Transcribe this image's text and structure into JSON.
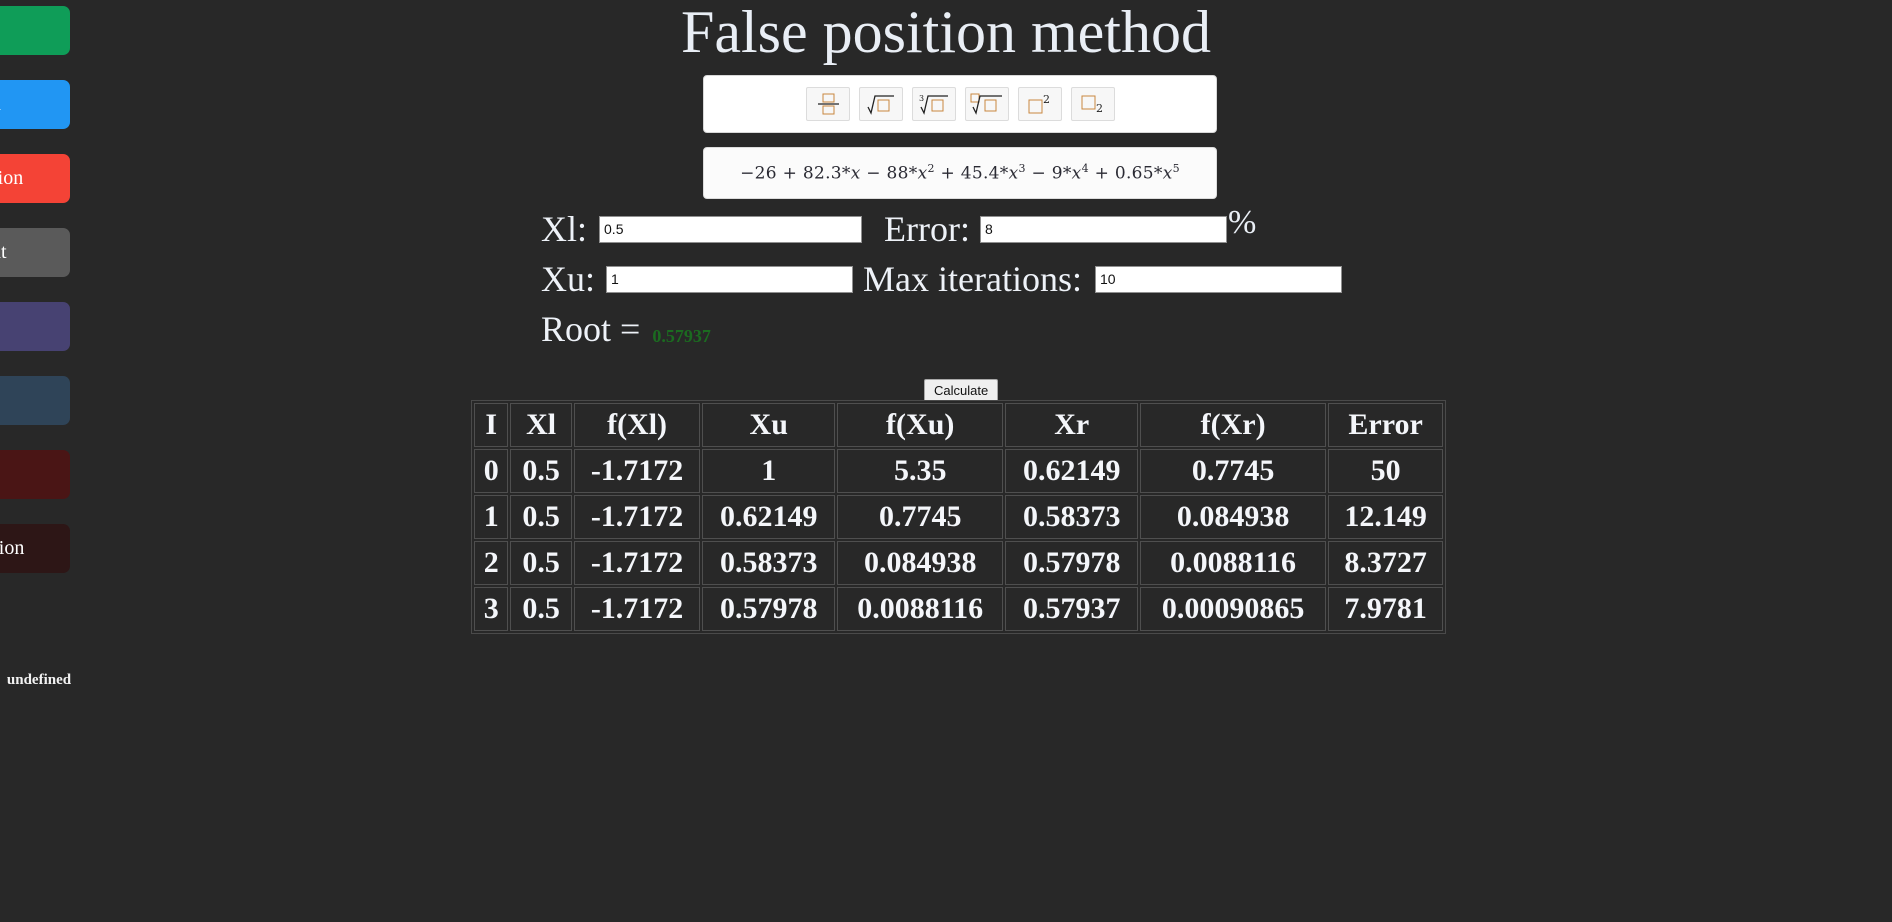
{
  "page": {
    "title": "False position method",
    "background_color": "#282828",
    "text_color": "#e9eef5"
  },
  "sidebar": {
    "status_text": "undefined",
    "items": [
      {
        "label": "",
        "color": "#0f9d58",
        "data_name": "sidebar-button-1"
      },
      {
        "label": "n",
        "color": "#2196f3",
        "data_name": "sidebar-button-newton"
      },
      {
        "label": "osition",
        "color": "#f44336",
        "data_name": "sidebar-button-false-position"
      },
      {
        "label": "int",
        "color": "#5a5a5a",
        "data_name": "sidebar-button-fixed-point"
      },
      {
        "label": "",
        "color": "#474272",
        "data_name": "sidebar-button-5"
      },
      {
        "label": "",
        "color": "#2f4458",
        "data_name": "sidebar-button-6"
      },
      {
        "label": "",
        "color": "#4a1515",
        "data_name": "sidebar-button-7"
      },
      {
        "label": "section",
        "color": "#2d1616",
        "data_name": "sidebar-button-bisection"
      }
    ]
  },
  "math_toolbar": {
    "buttons": [
      {
        "icon": "fraction-icon",
        "label": "Fraction"
      },
      {
        "icon": "square-root-icon",
        "label": "Square root"
      },
      {
        "icon": "cube-root-icon",
        "label": "Cube root"
      },
      {
        "icon": "nth-root-icon",
        "label": "Nth root"
      },
      {
        "icon": "superscript-icon",
        "label": "Superscript"
      },
      {
        "icon": "subscript-icon",
        "label": "Subscript"
      }
    ]
  },
  "formula": {
    "display": "−26 + 82.3*x − 88*x^2 + 45.4*x^3 − 9*x^4 + 0.65*x^5",
    "terms": [
      {
        "text": "−26 + 82.3*"
      },
      {
        "var": "x"
      },
      {
        "text": " − 88*"
      },
      {
        "var": "x",
        "exp": "2"
      },
      {
        "text": " + 45.4*"
      },
      {
        "var": "x",
        "exp": "3"
      },
      {
        "text": " − 9*"
      },
      {
        "var": "x",
        "exp": "4"
      },
      {
        "text": " + 0.65*"
      },
      {
        "var": "x",
        "exp": "5"
      }
    ]
  },
  "params": {
    "xl_label": "Xl:",
    "xl_value": "0.5",
    "error_label": "Error:",
    "error_value": "8",
    "percent_symbol": "%",
    "xu_label": "Xu:",
    "xu_value": "1",
    "maxiter_label": "Max iterations:",
    "maxiter_value": "10",
    "root_label": "Root =",
    "root_value": "0.57937",
    "root_color": "#1b6b20"
  },
  "actions": {
    "calculate_label": "Calculate"
  },
  "table": {
    "headers": [
      "I",
      "Xl",
      "f(Xl)",
      "Xu",
      "f(Xu)",
      "Xr",
      "f(Xr)",
      "Error"
    ],
    "rows": [
      [
        "0",
        "0.5",
        "-1.7172",
        "1",
        "5.35",
        "0.62149",
        "0.7745",
        "50"
      ],
      [
        "1",
        "0.5",
        "-1.7172",
        "0.62149",
        "0.7745",
        "0.58373",
        "0.084938",
        "12.149"
      ],
      [
        "2",
        "0.5",
        "-1.7172",
        "0.58373",
        "0.084938",
        "0.57978",
        "0.0088116",
        "8.3727"
      ],
      [
        "3",
        "0.5",
        "-1.7172",
        "0.57978",
        "0.0088116",
        "0.57937",
        "0.00090865",
        "7.9781"
      ]
    ]
  }
}
